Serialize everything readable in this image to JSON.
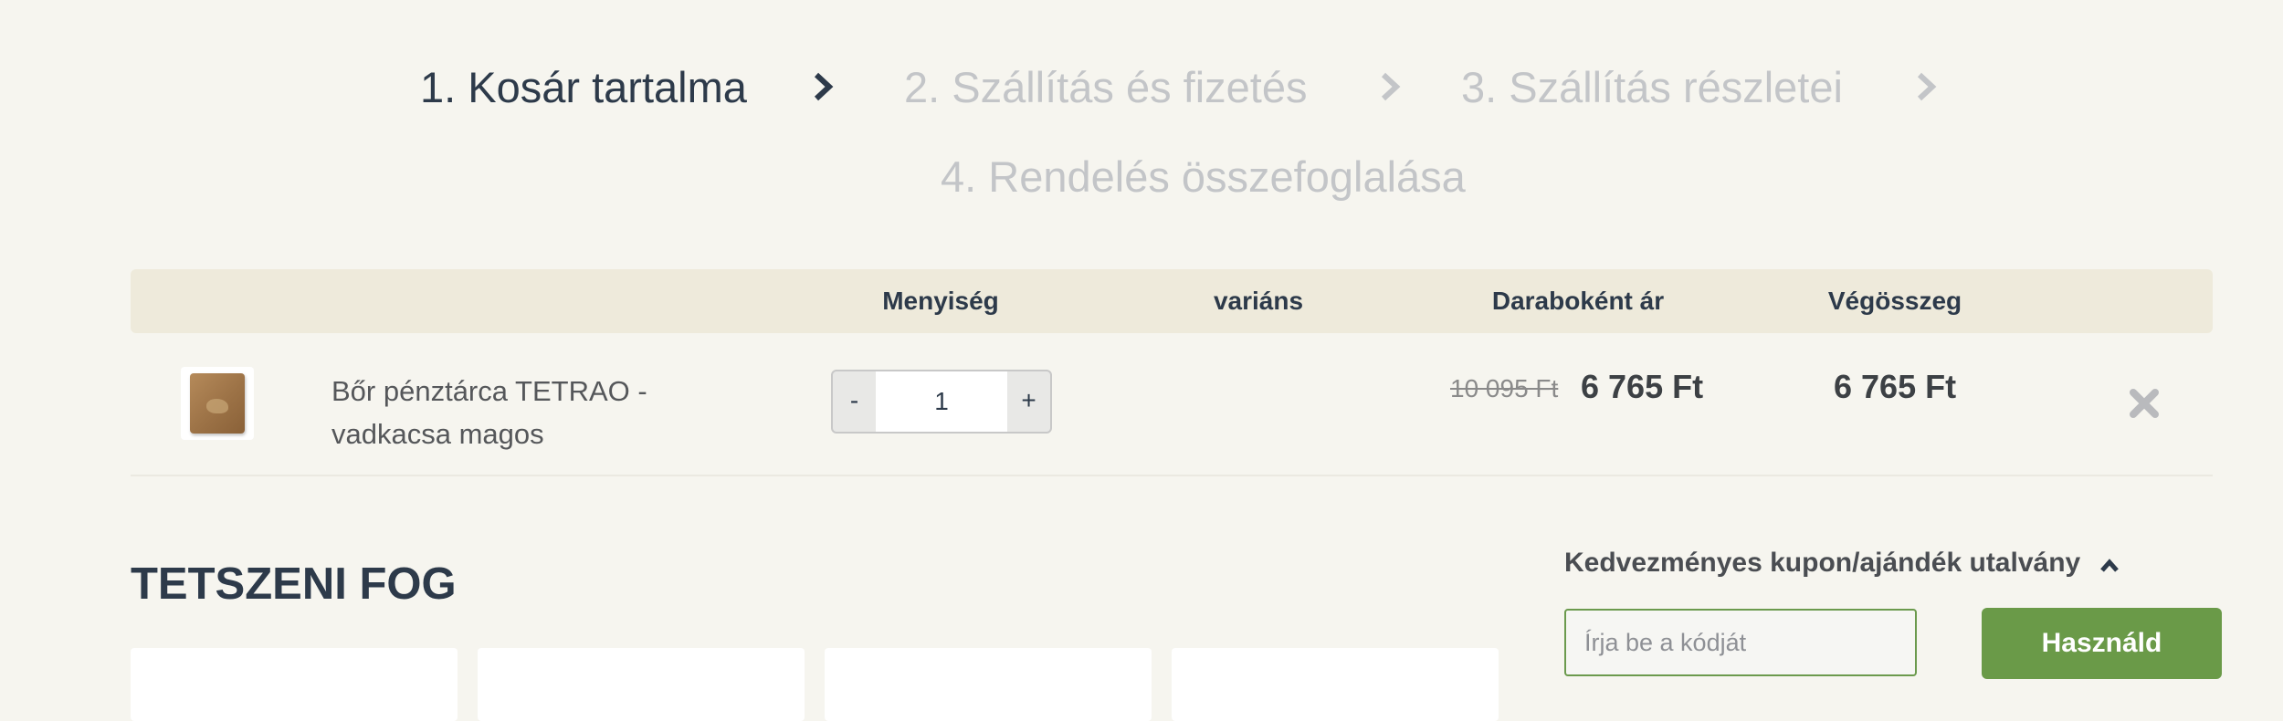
{
  "steps": [
    {
      "label": "1. Kosár tartalma",
      "state": "active"
    },
    {
      "label": "2. Szállítás és fizetés",
      "state": "inactive"
    },
    {
      "label": "3. Szállítás részletei",
      "state": "inactive"
    },
    {
      "label": "4. Rendelés összefoglalása",
      "state": "inactive"
    }
  ],
  "cart": {
    "headers": {
      "quantity": "Menyiség",
      "variant": "variáns",
      "unit_price": "Daraboként ár",
      "total": "Végösszeg"
    },
    "items": [
      {
        "name": "Bőr pénztárca TETRAO - vadkacsa magos",
        "minus_label": "-",
        "quantity": "1",
        "plus_label": "+",
        "old_price": "10 095 Ft",
        "price": "6 765 Ft",
        "total": "6 765 Ft",
        "thumbnail_icon": "wallet-image"
      }
    ]
  },
  "recommendations": {
    "title": "TETSZENI FOG"
  },
  "coupon": {
    "title": "Kedvezményes kupon/ajándék utalvány",
    "placeholder": "Írja be a kódját",
    "value": "",
    "button_label": "Használd"
  },
  "colors": {
    "background": "#f6f5ef",
    "header_bg": "#eeeadb",
    "accent_green": "#6a9a48",
    "text_dark": "#2d3a4a",
    "text_inactive": "#c3c5c8"
  }
}
